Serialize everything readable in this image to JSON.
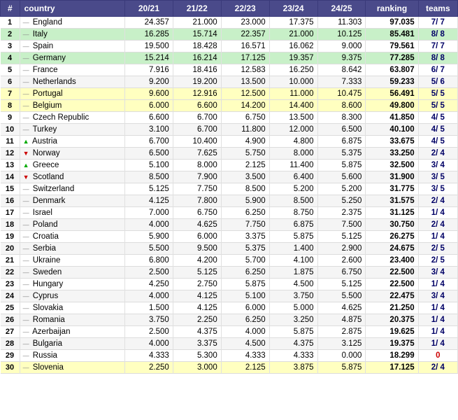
{
  "table": {
    "headers": [
      "#",
      "country",
      "20/21",
      "21/22",
      "22/23",
      "23/24",
      "24/25",
      "ranking",
      "teams"
    ],
    "rows": [
      {
        "rank": 1,
        "trend": "neutral",
        "country": "England",
        "y2021": "24.357",
        "y2122": "21.000",
        "y2223": "23.000",
        "y2324": "17.375",
        "y2425": "11.303",
        "ranking": "97.035",
        "teams": "7/ 7",
        "highlight": "none"
      },
      {
        "rank": 2,
        "trend": "neutral",
        "country": "Italy",
        "y2021": "16.285",
        "y2122": "15.714",
        "y2223": "22.357",
        "y2324": "21.000",
        "y2425": "10.125",
        "ranking": "85.481",
        "teams": "8/ 8",
        "highlight": "green"
      },
      {
        "rank": 3,
        "trend": "neutral",
        "country": "Spain",
        "y2021": "19.500",
        "y2122": "18.428",
        "y2223": "16.571",
        "y2324": "16.062",
        "y2425": "9.000",
        "ranking": "79.561",
        "teams": "7/ 7",
        "highlight": "none"
      },
      {
        "rank": 4,
        "trend": "neutral",
        "country": "Germany",
        "y2021": "15.214",
        "y2122": "16.214",
        "y2223": "17.125",
        "y2324": "19.357",
        "y2425": "9.375",
        "ranking": "77.285",
        "teams": "8/ 8",
        "highlight": "green"
      },
      {
        "rank": 5,
        "trend": "neutral",
        "country": "France",
        "y2021": "7.916",
        "y2122": "18.416",
        "y2223": "12.583",
        "y2324": "16.250",
        "y2425": "8.642",
        "ranking": "63.807",
        "teams": "6/ 7",
        "highlight": "none"
      },
      {
        "rank": 6,
        "trend": "neutral",
        "country": "Netherlands",
        "y2021": "9.200",
        "y2122": "19.200",
        "y2223": "13.500",
        "y2324": "10.000",
        "y2425": "7.333",
        "ranking": "59.233",
        "teams": "5/ 6",
        "highlight": "none"
      },
      {
        "rank": 7,
        "trend": "neutral",
        "country": "Portugal",
        "y2021": "9.600",
        "y2122": "12.916",
        "y2223": "12.500",
        "y2324": "11.000",
        "y2425": "10.475",
        "ranking": "56.491",
        "teams": "5/ 5",
        "highlight": "yellow"
      },
      {
        "rank": 8,
        "trend": "neutral",
        "country": "Belgium",
        "y2021": "6.000",
        "y2122": "6.600",
        "y2223": "14.200",
        "y2324": "14.400",
        "y2425": "8.600",
        "ranking": "49.800",
        "teams": "5/ 5",
        "highlight": "yellow"
      },
      {
        "rank": 9,
        "trend": "neutral",
        "country": "Czech Republic",
        "y2021": "6.600",
        "y2122": "6.700",
        "y2223": "6.750",
        "y2324": "13.500",
        "y2425": "8.300",
        "ranking": "41.850",
        "teams": "4/ 5",
        "highlight": "none"
      },
      {
        "rank": 10,
        "trend": "neutral",
        "country": "Turkey",
        "y2021": "3.100",
        "y2122": "6.700",
        "y2223": "11.800",
        "y2324": "12.000",
        "y2425": "6.500",
        "ranking": "40.100",
        "teams": "4/ 5",
        "highlight": "none"
      },
      {
        "rank": 11,
        "trend": "up",
        "country": "Austria",
        "y2021": "6.700",
        "y2122": "10.400",
        "y2223": "4.900",
        "y2324": "4.800",
        "y2425": "6.875",
        "ranking": "33.675",
        "teams": "4/ 5",
        "highlight": "none"
      },
      {
        "rank": 12,
        "trend": "down",
        "country": "Norway",
        "y2021": "6.500",
        "y2122": "7.625",
        "y2223": "5.750",
        "y2324": "8.000",
        "y2425": "5.375",
        "ranking": "33.250",
        "teams": "2/ 4",
        "highlight": "none"
      },
      {
        "rank": 13,
        "trend": "up",
        "country": "Greece",
        "y2021": "5.100",
        "y2122": "8.000",
        "y2223": "2.125",
        "y2324": "11.400",
        "y2425": "5.875",
        "ranking": "32.500",
        "teams": "3/ 4",
        "highlight": "none"
      },
      {
        "rank": 14,
        "trend": "down",
        "country": "Scotland",
        "y2021": "8.500",
        "y2122": "7.900",
        "y2223": "3.500",
        "y2324": "6.400",
        "y2425": "5.600",
        "ranking": "31.900",
        "teams": "3/ 5",
        "highlight": "none"
      },
      {
        "rank": 15,
        "trend": "neutral",
        "country": "Switzerland",
        "y2021": "5.125",
        "y2122": "7.750",
        "y2223": "8.500",
        "y2324": "5.200",
        "y2425": "5.200",
        "ranking": "31.775",
        "teams": "3/ 5",
        "highlight": "none"
      },
      {
        "rank": 16,
        "trend": "neutral",
        "country": "Denmark",
        "y2021": "4.125",
        "y2122": "7.800",
        "y2223": "5.900",
        "y2324": "8.500",
        "y2425": "5.250",
        "ranking": "31.575",
        "teams": "2/ 4",
        "highlight": "none"
      },
      {
        "rank": 17,
        "trend": "neutral",
        "country": "Israel",
        "y2021": "7.000",
        "y2122": "6.750",
        "y2223": "6.250",
        "y2324": "8.750",
        "y2425": "2.375",
        "ranking": "31.125",
        "teams": "1/ 4",
        "highlight": "none"
      },
      {
        "rank": 18,
        "trend": "neutral",
        "country": "Poland",
        "y2021": "4.000",
        "y2122": "4.625",
        "y2223": "7.750",
        "y2324": "6.875",
        "y2425": "7.500",
        "ranking": "30.750",
        "teams": "2/ 4",
        "highlight": "none"
      },
      {
        "rank": 19,
        "trend": "neutral",
        "country": "Croatia",
        "y2021": "5.900",
        "y2122": "6.000",
        "y2223": "3.375",
        "y2324": "5.875",
        "y2425": "5.125",
        "ranking": "26.275",
        "teams": "1/ 4",
        "highlight": "none"
      },
      {
        "rank": 20,
        "trend": "neutral",
        "country": "Serbia",
        "y2021": "5.500",
        "y2122": "9.500",
        "y2223": "5.375",
        "y2324": "1.400",
        "y2425": "2.900",
        "ranking": "24.675",
        "teams": "2/ 5",
        "highlight": "none"
      },
      {
        "rank": 21,
        "trend": "neutral",
        "country": "Ukraine",
        "y2021": "6.800",
        "y2122": "4.200",
        "y2223": "5.700",
        "y2324": "4.100",
        "y2425": "2.600",
        "ranking": "23.400",
        "teams": "2/ 5",
        "highlight": "none"
      },
      {
        "rank": 22,
        "trend": "neutral",
        "country": "Sweden",
        "y2021": "2.500",
        "y2122": "5.125",
        "y2223": "6.250",
        "y2324": "1.875",
        "y2425": "6.750",
        "ranking": "22.500",
        "teams": "3/ 4",
        "highlight": "none"
      },
      {
        "rank": 23,
        "trend": "neutral",
        "country": "Hungary",
        "y2021": "4.250",
        "y2122": "2.750",
        "y2223": "5.875",
        "y2324": "4.500",
        "y2425": "5.125",
        "ranking": "22.500",
        "teams": "1/ 4",
        "highlight": "none"
      },
      {
        "rank": 24,
        "trend": "neutral",
        "country": "Cyprus",
        "y2021": "4.000",
        "y2122": "4.125",
        "y2223": "5.100",
        "y2324": "3.750",
        "y2425": "5.500",
        "ranking": "22.475",
        "teams": "3/ 4",
        "highlight": "none"
      },
      {
        "rank": 25,
        "trend": "neutral",
        "country": "Slovakia",
        "y2021": "1.500",
        "y2122": "4.125",
        "y2223": "6.000",
        "y2324": "5.000",
        "y2425": "4.625",
        "ranking": "21.250",
        "teams": "1/ 4",
        "highlight": "none"
      },
      {
        "rank": 26,
        "trend": "neutral",
        "country": "Romania",
        "y2021": "3.750",
        "y2122": "2.250",
        "y2223": "6.250",
        "y2324": "3.250",
        "y2425": "4.875",
        "ranking": "20.375",
        "teams": "1/ 4",
        "highlight": "none"
      },
      {
        "rank": 27,
        "trend": "neutral",
        "country": "Azerbaijan",
        "y2021": "2.500",
        "y2122": "4.375",
        "y2223": "4.000",
        "y2324": "5.875",
        "y2425": "2.875",
        "ranking": "19.625",
        "teams": "1/ 4",
        "highlight": "none"
      },
      {
        "rank": 28,
        "trend": "neutral",
        "country": "Bulgaria",
        "y2021": "4.000",
        "y2122": "3.375",
        "y2223": "4.500",
        "y2324": "4.375",
        "y2425": "3.125",
        "ranking": "19.375",
        "teams": "1/ 4",
        "highlight": "none"
      },
      {
        "rank": 29,
        "trend": "neutral",
        "country": "Russia",
        "y2021": "4.333",
        "y2122": "5.300",
        "y2223": "4.333",
        "y2324": "4.333",
        "y2425": "0.000",
        "ranking": "18.299",
        "teams": "0",
        "highlight": "none"
      },
      {
        "rank": 30,
        "trend": "neutral",
        "country": "Slovenia",
        "y2021": "2.250",
        "y2122": "3.000",
        "y2223": "2.125",
        "y2324": "3.875",
        "y2425": "5.875",
        "ranking": "17.125",
        "teams": "2/ 4",
        "highlight": "yellow"
      }
    ]
  }
}
